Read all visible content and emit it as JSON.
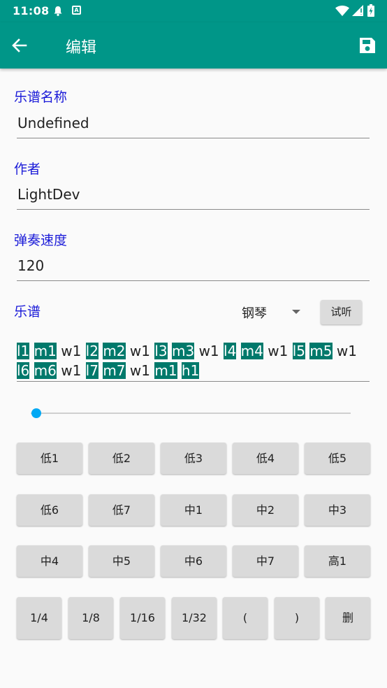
{
  "status_bar": {
    "time": "11:08",
    "notif_a": "A"
  },
  "app_bar": {
    "title": "编辑",
    "back_icon": "arrow-left-icon",
    "save_icon": "floppy-disk-icon"
  },
  "form": {
    "name_label": "乐谱名称",
    "name_value": "Undefined",
    "author_label": "作者",
    "author_value": "LightDev",
    "speed_label": "弹奏速度",
    "speed_value": "120",
    "score_label": "乐谱",
    "instrument": "钢琴",
    "listen_button": "试听"
  },
  "score_tokens": [
    {
      "t": "l1",
      "hl": true
    },
    {
      "t": "m1",
      "hl": true
    },
    {
      "t": "w1",
      "hl": false
    },
    {
      "t": "l2",
      "hl": true
    },
    {
      "t": "m2",
      "hl": true
    },
    {
      "t": "w1",
      "hl": false
    },
    {
      "t": "l3",
      "hl": true
    },
    {
      "t": "m3",
      "hl": true
    },
    {
      "t": "w1",
      "hl": false
    },
    {
      "t": "l4",
      "hl": true
    },
    {
      "t": "m4",
      "hl": true
    },
    {
      "t": "w1",
      "hl": false
    },
    {
      "t": "l5",
      "hl": true
    },
    {
      "t": "m5",
      "hl": true
    },
    {
      "t": "w1",
      "hl": false
    },
    {
      "t": "l6",
      "hl": true
    },
    {
      "t": "m6",
      "hl": true
    },
    {
      "t": "w1",
      "hl": false
    },
    {
      "t": "l7",
      "hl": true
    },
    {
      "t": "m7",
      "hl": true
    },
    {
      "t": "w1",
      "hl": false
    },
    {
      "t": "m1",
      "hl": true
    },
    {
      "t": "h1",
      "hl": true
    }
  ],
  "slider": {
    "value": 0
  },
  "note_keys": [
    "低1",
    "低2",
    "低3",
    "低4",
    "低5",
    "低6",
    "低7",
    "中1",
    "中2",
    "中3",
    "中4",
    "中5",
    "中6",
    "中7",
    "高1"
  ],
  "duration_keys": [
    "1/4",
    "1/8",
    "1/16",
    "1/32",
    "(",
    ")",
    "删"
  ],
  "colors": {
    "primary": "#009688",
    "highlight": "#00796b",
    "label": "#1a1ad8",
    "slider": "#03a9f4"
  }
}
